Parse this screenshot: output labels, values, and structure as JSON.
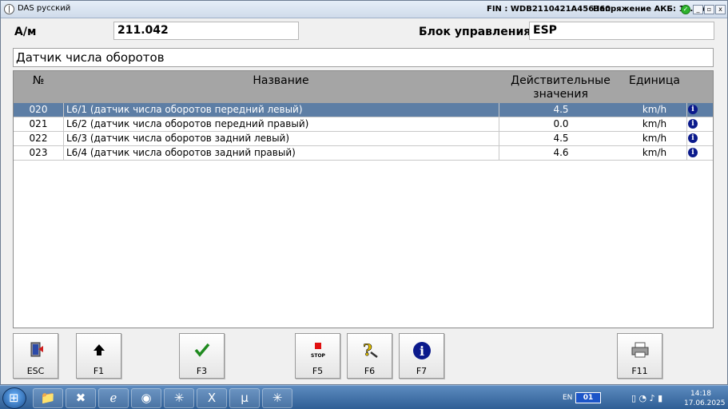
{
  "window": {
    "title": "DAS русский",
    "fin": "FIN : WDB2110421A456360",
    "battery": "Напряжение АКБ: 12.8 V",
    "controls": [
      "_",
      "▫",
      "x"
    ]
  },
  "header": {
    "model_label": "А/м",
    "model_value": "211.042",
    "ecu_label": "Блок управления",
    "ecu_value": "ESP"
  },
  "subtitle": "Датчик числа оборотов",
  "table": {
    "columns": {
      "no": "№",
      "name": "Название",
      "value_line1": "Действительные",
      "value_line2": "значения",
      "unit": "Единица"
    },
    "rows": [
      {
        "no": "020",
        "name": "L6/1 (датчик числа оборотов передний левый)",
        "value": "4.5",
        "unit": "km/h",
        "selected": true
      },
      {
        "no": "021",
        "name": "L6/2 (датчик числа оборотов передний правый)",
        "value": "0.0",
        "unit": "km/h",
        "selected": false
      },
      {
        "no": "022",
        "name": "L6/3 (датчик числа оборотов задний левый)",
        "value": "4.5",
        "unit": "km/h",
        "selected": false
      },
      {
        "no": "023",
        "name": "L6/4 (датчик числа оборотов задний правый)",
        "value": "4.6",
        "unit": "km/h",
        "selected": false
      }
    ],
    "info_glyph": "i"
  },
  "function_keys": [
    {
      "label": "ESC",
      "icon": "exit-door-icon"
    },
    {
      "label": "F1",
      "icon": "arrow-up-icon"
    },
    {
      "label": "F3",
      "icon": "checkmark-icon"
    },
    {
      "label": "F5",
      "icon": "stop-icon",
      "icon_text": "STOP"
    },
    {
      "label": "F6",
      "icon": "help-icon"
    },
    {
      "label": "F7",
      "icon": "info-icon"
    },
    {
      "label": "F11",
      "icon": "printer-icon"
    }
  ],
  "taskbar": {
    "lang": "EN",
    "badge": "01",
    "time": "14:18",
    "date": "17.06.2025"
  },
  "colors": {
    "selected_row": "#5d7ea5",
    "table_header": "#a5a5a5",
    "info_icon": "#0b1a8c",
    "ok_indicator": "#2db32d"
  }
}
